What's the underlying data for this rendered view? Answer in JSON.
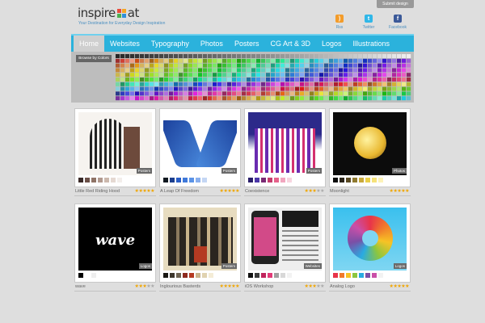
{
  "header": {
    "logo_left": "inspire",
    "logo_right": "at",
    "logo_squares": [
      "#e84b3c",
      "#f5a623",
      "#4caf50",
      "#2f8fd8"
    ],
    "tagline": "Your Destination for Everyday Design Inspiration",
    "submit_label": "Submit design",
    "social": [
      {
        "label": "Rss",
        "icon": "rss-icon",
        "color": "#f39c2b",
        "glyph": ")"
      },
      {
        "label": "Twitter",
        "icon": "twitter-icon",
        "color": "#30b7e8",
        "glyph": "t"
      },
      {
        "label": "Facebook",
        "icon": "facebook-icon",
        "color": "#3b5998",
        "glyph": "f"
      }
    ]
  },
  "nav": {
    "items": [
      "Home",
      "Websites",
      "Typography",
      "Photos",
      "Posters",
      "CG Art & 3D",
      "Logos",
      "Illustrations"
    ],
    "active": 0
  },
  "colors": {
    "label": "Browse by Colors"
  },
  "gallery": [
    {
      "title": "Little Red Riding Hood",
      "category": "Posters",
      "rating": 5,
      "palette": [
        "#3a2a28",
        "#6b5048",
        "#8f7366",
        "#b29a8f",
        "#ccb9ae",
        "#e5d9d2",
        "#f3eeeb",
        "#ffffff"
      ]
    },
    {
      "title": "A Leap Of Freedom",
      "category": "Posters",
      "rating": 5,
      "palette": [
        "#101820",
        "#1c3f8f",
        "#2a5ec7",
        "#3f79d9",
        "#5b93e6",
        "#8ab0ee",
        "#c4d6f4",
        "#ffffff"
      ]
    },
    {
      "title": "Coexistence",
      "category": "Posters",
      "rating": 3,
      "palette": [
        "#2a1f6b",
        "#4b37a8",
        "#7a2a74",
        "#c43d6e",
        "#e5628b",
        "#f1a6bf",
        "#f7d5e0",
        "#ffffff"
      ]
    },
    {
      "title": "Moonlight",
      "category": "Photos",
      "rating": 5,
      "palette": [
        "#0b0b0b",
        "#2a2418",
        "#5a4a24",
        "#8f7a30",
        "#c9a93a",
        "#e9cf4a",
        "#f6e27a",
        "#fdf3b8"
      ]
    },
    {
      "title": "wave",
      "category": "Logos",
      "rating": 3,
      "palette": [
        "#000000",
        "#ffffff",
        "#eeeeee"
      ]
    },
    {
      "title": "Inglourious Basterds",
      "category": "Posters",
      "rating": 5,
      "palette": [
        "#1a1814",
        "#3c362c",
        "#6e6352",
        "#8d2a1e",
        "#b43a22",
        "#c9b48c",
        "#e0d2b0",
        "#f4ecd6"
      ]
    },
    {
      "title": "iOS Workshop",
      "category": "Websites",
      "rating": 3,
      "palette": [
        "#111111",
        "#3a3a3a",
        "#c0245c",
        "#e23b78",
        "#a0a0a0",
        "#d8d8d8",
        "#f2f2f2"
      ]
    },
    {
      "title": "Analog Logo",
      "category": "Logos",
      "rating": 5,
      "palette": [
        "#e8344a",
        "#f07a2b",
        "#f7c325",
        "#8cc63f",
        "#29abe2",
        "#7b4fa6",
        "#c94fa8",
        "#f2f2f2"
      ]
    }
  ]
}
